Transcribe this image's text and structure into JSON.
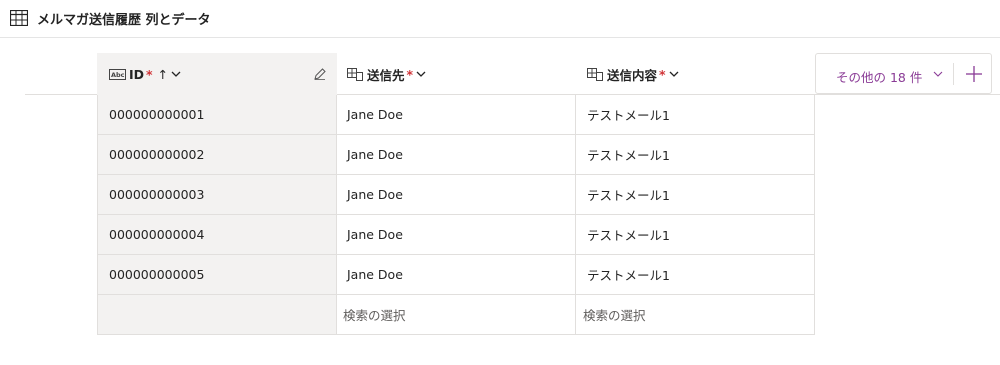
{
  "header": {
    "title": "メルマガ送信履歴 列とデータ",
    "icon": "table-icon"
  },
  "columns": [
    {
      "label": "ID",
      "required": "*",
      "sort": "↑",
      "icon": "text-field-icon"
    },
    {
      "label": "送信先",
      "required": "*",
      "icon": "lookup-icon"
    },
    {
      "label": "送信内容",
      "required": "*",
      "icon": "lookup-icon"
    }
  ],
  "rows": [
    {
      "id": "000000000001",
      "recipient": "Jane Doe",
      "content": "テストメール1"
    },
    {
      "id": "000000000002",
      "recipient": "Jane Doe",
      "content": "テストメール1"
    },
    {
      "id": "000000000003",
      "recipient": "Jane Doe",
      "content": "テストメール1"
    },
    {
      "id": "000000000004",
      "recipient": "Jane Doe",
      "content": "テストメール1"
    },
    {
      "id": "000000000005",
      "recipient": "Jane Doe",
      "content": "テストメール1"
    }
  ],
  "new_row": {
    "recipient_placeholder": "検索の選択",
    "content_placeholder": "検索の選択"
  },
  "more_columns": {
    "label": "その他の 18 件"
  },
  "colors": {
    "accent": "#8a3b96",
    "required": "#d13438",
    "id_column_bg": "#f3f2f1"
  }
}
